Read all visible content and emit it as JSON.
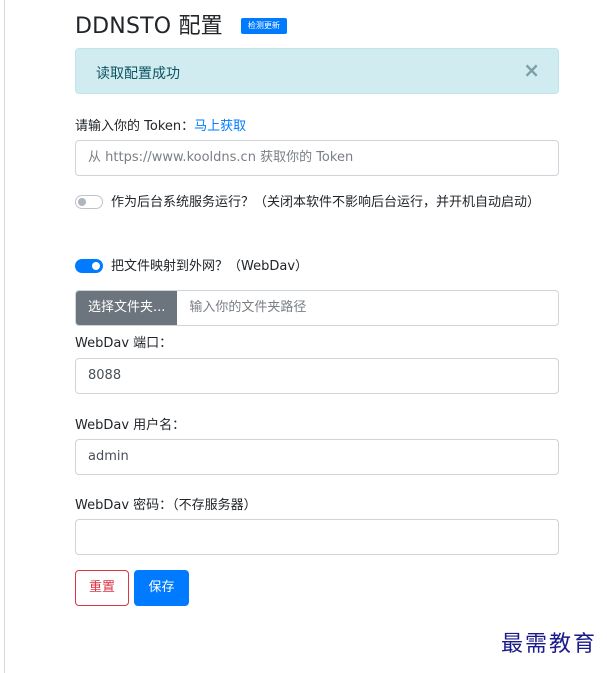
{
  "header": {
    "title": "DDNSTO 配置",
    "check_update_label": "检测更新"
  },
  "alert": {
    "message": "读取配置成功",
    "close_symbol": "×"
  },
  "token": {
    "label": "请输入你的 Token：",
    "link_text": "马上获取",
    "placeholder": "从 https://www.kooldns.cn 获取你的 Token",
    "value": ""
  },
  "background_service": {
    "label": "作为后台系统服务运行？（关闭本软件不影响后台运行，并开机自动启动）",
    "enabled": false
  },
  "webdav_map": {
    "label": "把文件映射到外网？（WebDav）",
    "enabled": true
  },
  "folder": {
    "button_label": "选择文件夹...",
    "placeholder": "输入你的文件夹路径"
  },
  "webdav_port": {
    "label": "WebDav 端口：",
    "value": "8088"
  },
  "webdav_user": {
    "label": "WebDav 用户名：",
    "value": "admin"
  },
  "webdav_password": {
    "label": "WebDav 密码：（不存服务器）",
    "value": ""
  },
  "actions": {
    "reset_label": "重置",
    "save_label": "保存"
  },
  "watermark": {
    "text": "最需教育"
  },
  "colors": {
    "primary": "#007bff",
    "danger": "#dc3545",
    "secondary": "#6c757d",
    "alert_bg": "#d1ecf1"
  }
}
